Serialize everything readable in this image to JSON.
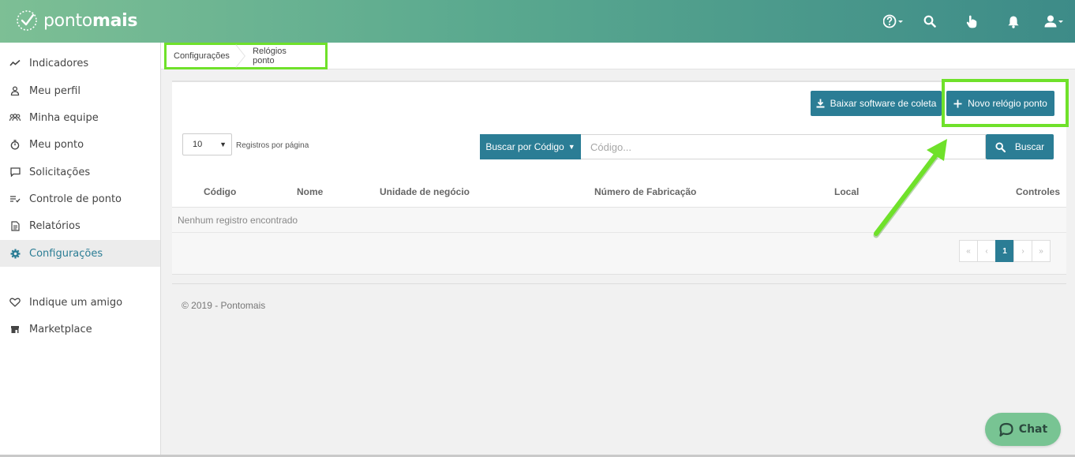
{
  "brand": {
    "name_light": "ponto",
    "name_bold": "mais"
  },
  "header": {
    "icons": [
      "help-icon",
      "search-icon",
      "hand-icon",
      "bell-icon",
      "user-icon"
    ]
  },
  "sidebar": {
    "items": [
      {
        "label": "Indicadores",
        "icon": "chart-line-icon"
      },
      {
        "label": "Meu perfil",
        "icon": "person-icon"
      },
      {
        "label": "Minha equipe",
        "icon": "team-icon"
      },
      {
        "label": "Meu ponto",
        "icon": "stopwatch-icon"
      },
      {
        "label": "Solicitações",
        "icon": "message-icon"
      },
      {
        "label": "Controle de ponto",
        "icon": "list-check-icon"
      },
      {
        "label": "Relatórios",
        "icon": "document-icon"
      },
      {
        "label": "Configurações",
        "icon": "gear-icon",
        "active": true
      },
      {
        "label": "Indique um amigo",
        "icon": "heart-icon"
      },
      {
        "label": "Marketplace",
        "icon": "store-icon"
      }
    ]
  },
  "breadcrumb": {
    "parent": "Configurações",
    "current": "Relógios ponto"
  },
  "toolbar": {
    "download_label": "Baixar software de coleta",
    "new_label": "Novo relógio ponto"
  },
  "table_controls": {
    "per_page_value": "10",
    "per_page_label": "Registros por página",
    "search_type_label": "Buscar por Código",
    "search_placeholder": "Código...",
    "search_button_label": "Buscar"
  },
  "table": {
    "columns": [
      "Código",
      "Nome",
      "Unidade de negócio",
      "Número de Fabricação",
      "Local",
      "Controles"
    ],
    "empty_message": "Nenhum registro encontrado"
  },
  "pagination": {
    "first": "«",
    "prev": "‹",
    "current": "1",
    "next": "›",
    "last": "»"
  },
  "footer": {
    "text": "© 2019 - Pontomais"
  },
  "chat": {
    "label": "Chat"
  },
  "colors": {
    "primary": "#2b7d95",
    "highlight": "#6fe12a",
    "header_start": "#7dbf95",
    "header_end": "#3d8b88"
  }
}
